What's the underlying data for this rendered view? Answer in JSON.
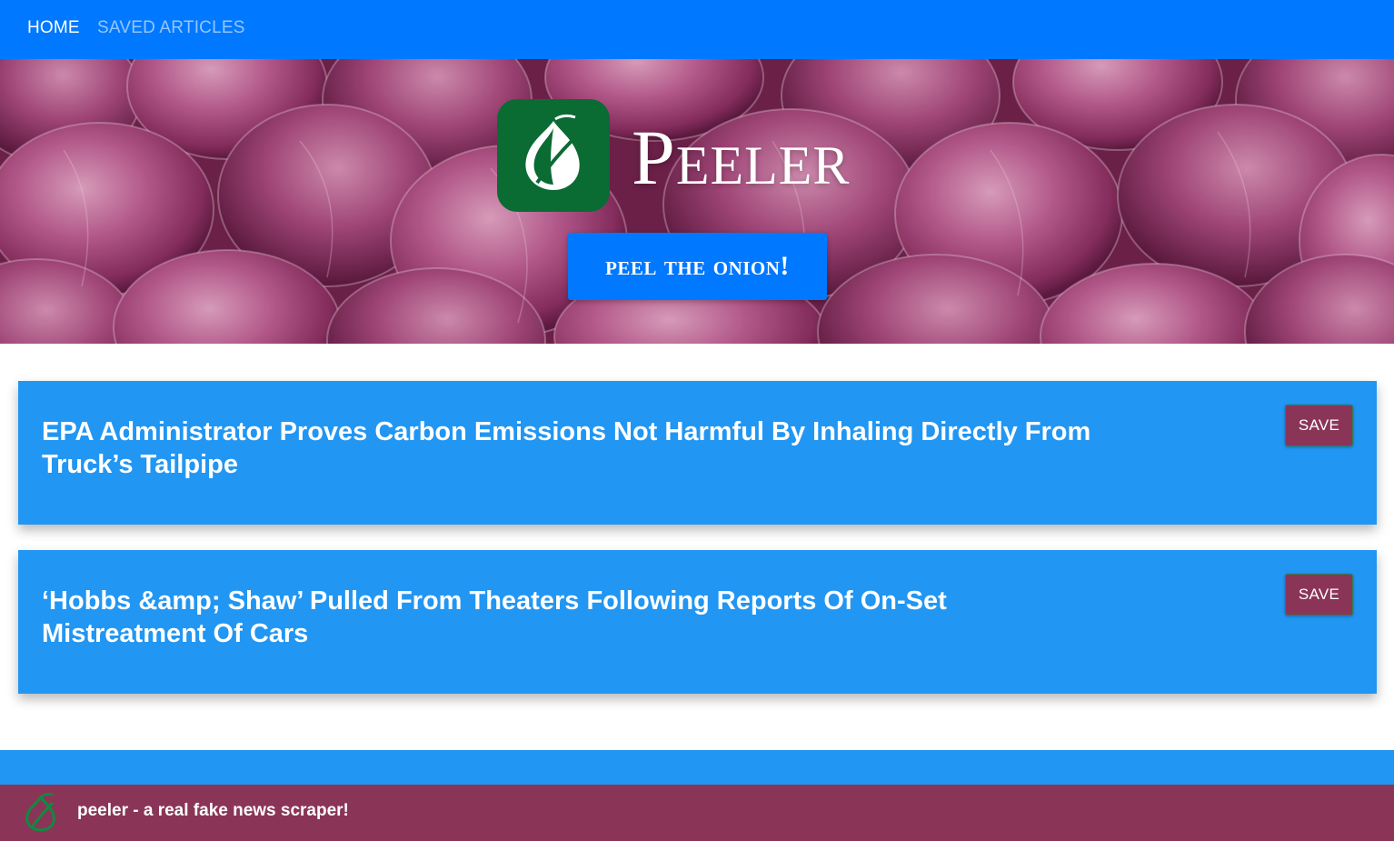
{
  "nav": {
    "home_label": "HOME",
    "saved_label": "SAVED ARTICLES"
  },
  "hero": {
    "brand": "Peeler",
    "peel_button_label": "peel the onion!",
    "logo_icon": "onion-icon"
  },
  "articles": [
    {
      "title": "EPA Administrator Proves Carbon Emissions Not Harmful By Inhaling Directly From Truck’s Tailpipe",
      "save_label": "SAVE"
    },
    {
      "title": "‘Hobbs &amp; Shaw’ Pulled From Theaters Following Reports Of On-Set Mistreatment Of Cars",
      "save_label": "SAVE"
    }
  ],
  "footer": {
    "text": "peeler - a real fake news scraper!",
    "logo_icon": "onion-icon"
  },
  "colors": {
    "nav_blue": "#0078ff",
    "card_blue": "#2196f3",
    "footer_maroon": "#8a3557",
    "logo_green": "#0a6b33"
  }
}
